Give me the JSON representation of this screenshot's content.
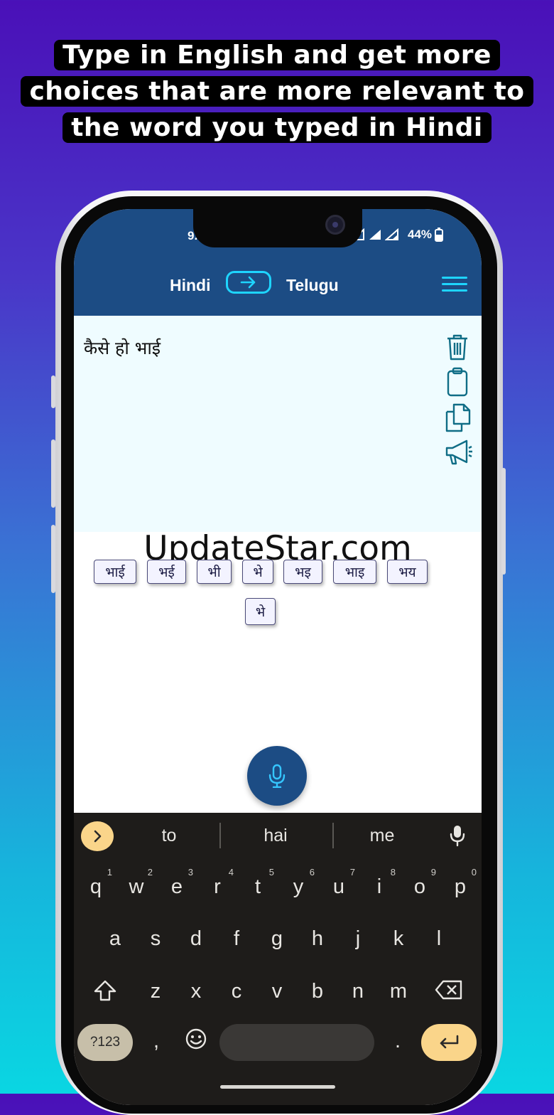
{
  "headline": {
    "line1": "Type in English and get more",
    "line2": "choices that are more relevant to",
    "line3": "the word you typed in Hindi"
  },
  "status_bar": {
    "time": "9.",
    "battery": "44%"
  },
  "app_bar": {
    "source_language": "Hindi",
    "target_language": "Telugu",
    "swap_icon": "arrow-right-icon",
    "menu_icon": "hamburger-menu-icon"
  },
  "input": {
    "text": "कैसे हो भाई"
  },
  "tools": [
    "trash-icon",
    "clipboard-icon",
    "copy-icon",
    "megaphone-icon"
  ],
  "watermark": "UpdateStar.com",
  "suggestions": [
    "भाई",
    "भई",
    "भी",
    "भे",
    "भइ",
    "भाइ",
    "भय",
    "भे"
  ],
  "keyboard": {
    "suggestions": [
      "to",
      "hai",
      "me"
    ],
    "row1": [
      [
        "q",
        "1"
      ],
      [
        "w",
        "2"
      ],
      [
        "e",
        "3"
      ],
      [
        "r",
        "4"
      ],
      [
        "t",
        "5"
      ],
      [
        "y",
        "6"
      ],
      [
        "u",
        "7"
      ],
      [
        "i",
        "8"
      ],
      [
        "o",
        "9"
      ],
      [
        "p",
        "0"
      ]
    ],
    "row2": [
      "a",
      "s",
      "d",
      "f",
      "g",
      "h",
      "j",
      "k",
      "l"
    ],
    "row3": [
      "z",
      "x",
      "c",
      "v",
      "b",
      "n",
      "m"
    ],
    "symbols_key": "?123",
    "comma": ",",
    "period": "."
  },
  "colors": {
    "app_bar": "#1c4c84",
    "accent": "#1ed5ff",
    "keyboard_bg": "#1e1c1a",
    "keyboard_accent": "#fad58a"
  }
}
